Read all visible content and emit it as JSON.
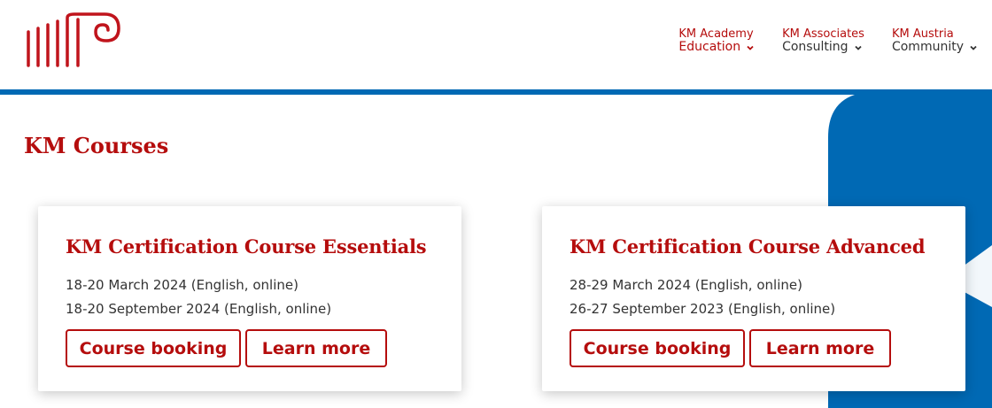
{
  "header": {
    "logo_alt": "KM logo",
    "nav": [
      {
        "top": "KM Academy",
        "bottom": "Education",
        "icon": "chevron-down-icon"
      },
      {
        "top": "KM Associates",
        "bottom": "Consulting",
        "icon": "chevron-down-icon"
      },
      {
        "top": "KM Austria",
        "bottom": "Community",
        "icon": "chevron-down-icon"
      }
    ]
  },
  "colors": {
    "brand_red": "#b50d0d",
    "brand_blue": "#0069b4"
  },
  "main": {
    "title": "KM Courses",
    "courses": [
      {
        "title": "KM Certification Course Essentials",
        "dates": [
          "18-20 March 2024 (English, online)",
          "18-20 September 2024 (English, online)"
        ],
        "booking_label": "Course booking",
        "learn_label": "Learn more"
      },
      {
        "title": "KM Certification Course Advanced",
        "dates": [
          "28-29 March 2024 (English, online)",
          "26-27 September 2023 (English, online)"
        ],
        "booking_label": "Course booking",
        "learn_label": "Learn more"
      }
    ]
  }
}
